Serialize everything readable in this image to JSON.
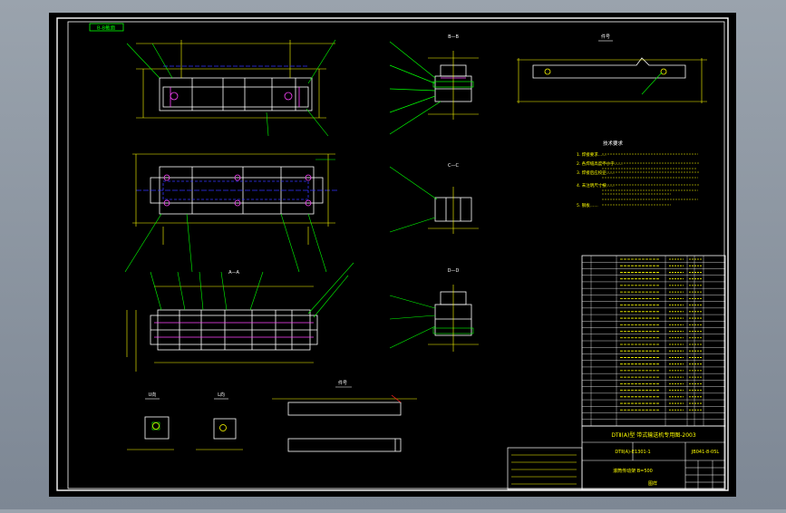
{
  "drawing": {
    "corner_tag": "B-B截面",
    "view_labels": {
      "b_b": "B—B",
      "c_c": "C—C",
      "d_d": "D—D",
      "a_a": "A—A",
      "u_view": "U向",
      "l_view": "L向",
      "part_top": "件号",
      "part_bottom": "件号"
    },
    "notes": {
      "title": "技术要求",
      "lines": [
        "1. 焊接要求……",
        "2. 各焊缝高度不小于……",
        "3. 焊接后应校正……",
        "4. 未注明尺寸按……",
        "5. 钢板……"
      ]
    },
    "title_block": {
      "company": "DTⅡ(A)型 带式输送机专用图-2003",
      "drawing_no": "DTⅡ(A)-E1301-1",
      "code": "JB041-8-05L",
      "part_name": "滚筒传动架 B=500",
      "stage": "图样"
    },
    "bom_rows": 26,
    "colors": {
      "paper": "#000000",
      "frame": "#ffffff",
      "outline": "#ffffff",
      "yellow": "#ffff00",
      "green": "#00ff00",
      "magenta": "#ff44ff",
      "blue": "#3333ff",
      "cyan": "#00ffff",
      "red": "#ff2020"
    }
  }
}
